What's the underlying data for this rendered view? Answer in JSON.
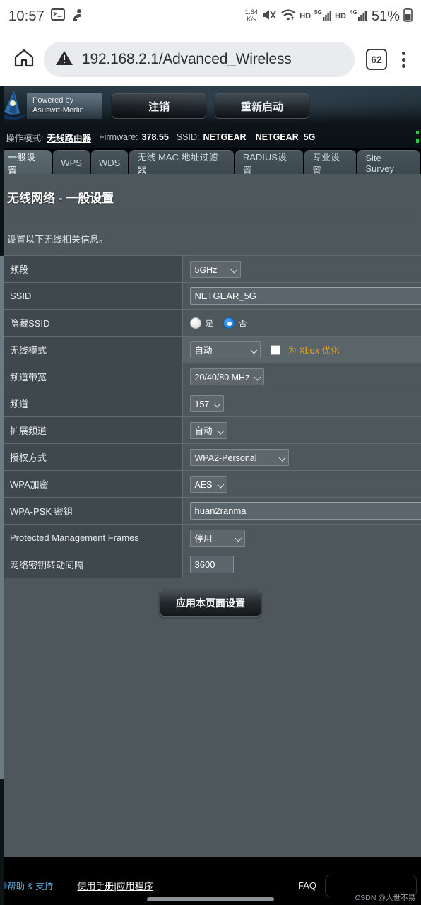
{
  "status_bar": {
    "time": "10:57",
    "icons_left": [
      "terminal-icon",
      "app-icon"
    ],
    "data_rate_top": "1.64",
    "data_rate_bottom": "K/s",
    "mute_icon": "volume-mute-icon",
    "wifi_icon": "wifi-icon",
    "hd1": "HD",
    "net1": "5G",
    "hd2": "HD",
    "net2": "4G",
    "battery_percent": "51%"
  },
  "browser": {
    "home_icon": "home-icon",
    "security_icon": "not-secure-warning-icon",
    "url": "192.168.2.1/Advanced_Wireless",
    "tab_count": "62",
    "menu_icon": "overflow-menu-icon"
  },
  "router_header": {
    "logo_line1": "Powered by",
    "logo_line2": "Asuswrt-Merlin",
    "logout_label": "注销",
    "reboot_label": "重新启动"
  },
  "info_bar": {
    "mode_label": "操作模式:",
    "mode_value": "无线路由器",
    "firmware_label": "Firmware:",
    "firmware_value": "378.55",
    "ssid_label": "SSID:",
    "ssid_value_1": "NETGEAR",
    "ssid_value_2": "NETGEAR_5G"
  },
  "tabs": [
    {
      "label": "一般设置",
      "active": true
    },
    {
      "label": "WPS",
      "active": false
    },
    {
      "label": "WDS",
      "active": false
    },
    {
      "label": "无线 MAC 地址过滤器",
      "active": false
    },
    {
      "label": "RADIUS设置",
      "active": false
    },
    {
      "label": "专业设置",
      "active": false
    },
    {
      "label": "Site Survey",
      "active": false
    }
  ],
  "page": {
    "title": "无线网络 - 一般设置",
    "description": "设置以下无线相关信息。",
    "apply_button": "应用本页面设置"
  },
  "form": {
    "band": {
      "key": "频段",
      "value": "5GHz"
    },
    "ssid": {
      "key": "SSID",
      "value": "NETGEAR_5G"
    },
    "hide_ssid": {
      "key": "隐藏SSID",
      "yes": "是",
      "no": "否",
      "selected": "否"
    },
    "wireless_mode": {
      "key": "无线模式",
      "value": "自动",
      "xbox_label": "为 Xbox 优化",
      "xbox_checked": false
    },
    "channel_bandwidth": {
      "key": "频道带宽",
      "value": "20/40/80 MHz"
    },
    "channel": {
      "key": "频道",
      "value": "157"
    },
    "ext_channel": {
      "key": "扩展频道",
      "value": "自动"
    },
    "auth_method": {
      "key": "授权方式",
      "value": "WPA2-Personal"
    },
    "wpa_encryption": {
      "key": "WPA加密",
      "value": "AES"
    },
    "wpa_psk": {
      "key": "WPA-PSK 密钥",
      "value": "huan2ranma"
    },
    "pmf": {
      "key": "Protected Management Frames",
      "value": "停用"
    },
    "rotation_interval": {
      "key": "网络密钥转动间隔",
      "value": "3600"
    }
  },
  "footer": {
    "help_label": "帮助 & 支持",
    "manual_label": "使用手册",
    "separator": "|",
    "apps_label": "应用程序",
    "faq_label": "FAQ",
    "watermark": "CSDN @人世不易"
  },
  "colors": {
    "accent_orange": "#e8a317",
    "radio_blue": "#0a72d8",
    "panel_bg": "#4e585c",
    "key_bg": "#3e484d",
    "footer_bg": "#000000"
  }
}
